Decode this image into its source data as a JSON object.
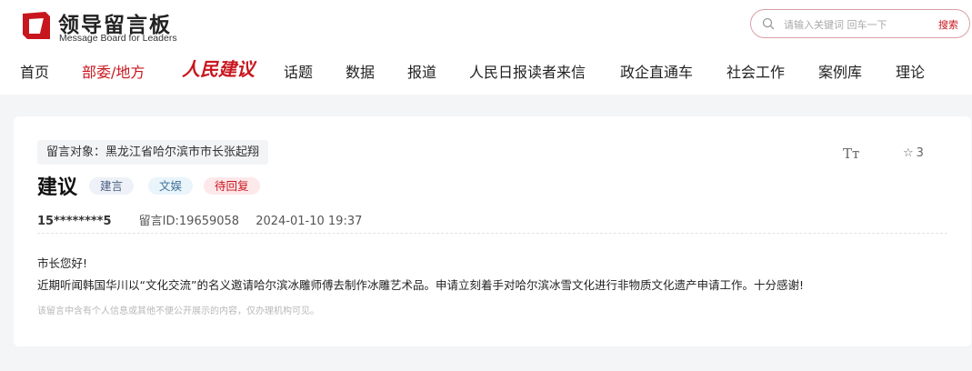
{
  "brand": {
    "title": "领导留言板",
    "subtitle": "Message Board for Leaders",
    "color": "#c8161e"
  },
  "search": {
    "placeholder": "请输入关键词 回车一下",
    "button_label": "搜索",
    "icon": "search-icon"
  },
  "nav": {
    "items": [
      {
        "label": "首页"
      },
      {
        "label": "部委/地方",
        "active": true
      },
      {
        "label": "人民建议"
      },
      {
        "label": "话题"
      },
      {
        "label": "数据"
      },
      {
        "label": "报道"
      },
      {
        "label": "人民日报读者来信"
      },
      {
        "label": "政企直通车"
      },
      {
        "label": "社会工作"
      },
      {
        "label": "案例库"
      },
      {
        "label": "理论"
      }
    ]
  },
  "message": {
    "target_label": "留言对象：黑龙江省哈尔滨市市长张起翔",
    "font_size_icon": "Tт",
    "favorite_count": "3",
    "title": "建议",
    "tags": {
      "type": "建言",
      "field": "文娱",
      "status": "待回复"
    },
    "user": "15********5",
    "id_text": "留言ID:19659058",
    "date": "2024-01-10 19:37",
    "greeting": "市长您好!",
    "body": "近期听闻韩国华川以“文化交流”的名义邀请哈尔滨冰雕师傅去制作冰雕艺术品。申请立刻着手对哈尔滨冰雪文化进行非物质文化遗产申请工作。十分感谢!",
    "privacy_note": "该留言中含有个人信息或其他不便公开展示的内容，仅办理机构可见。"
  }
}
